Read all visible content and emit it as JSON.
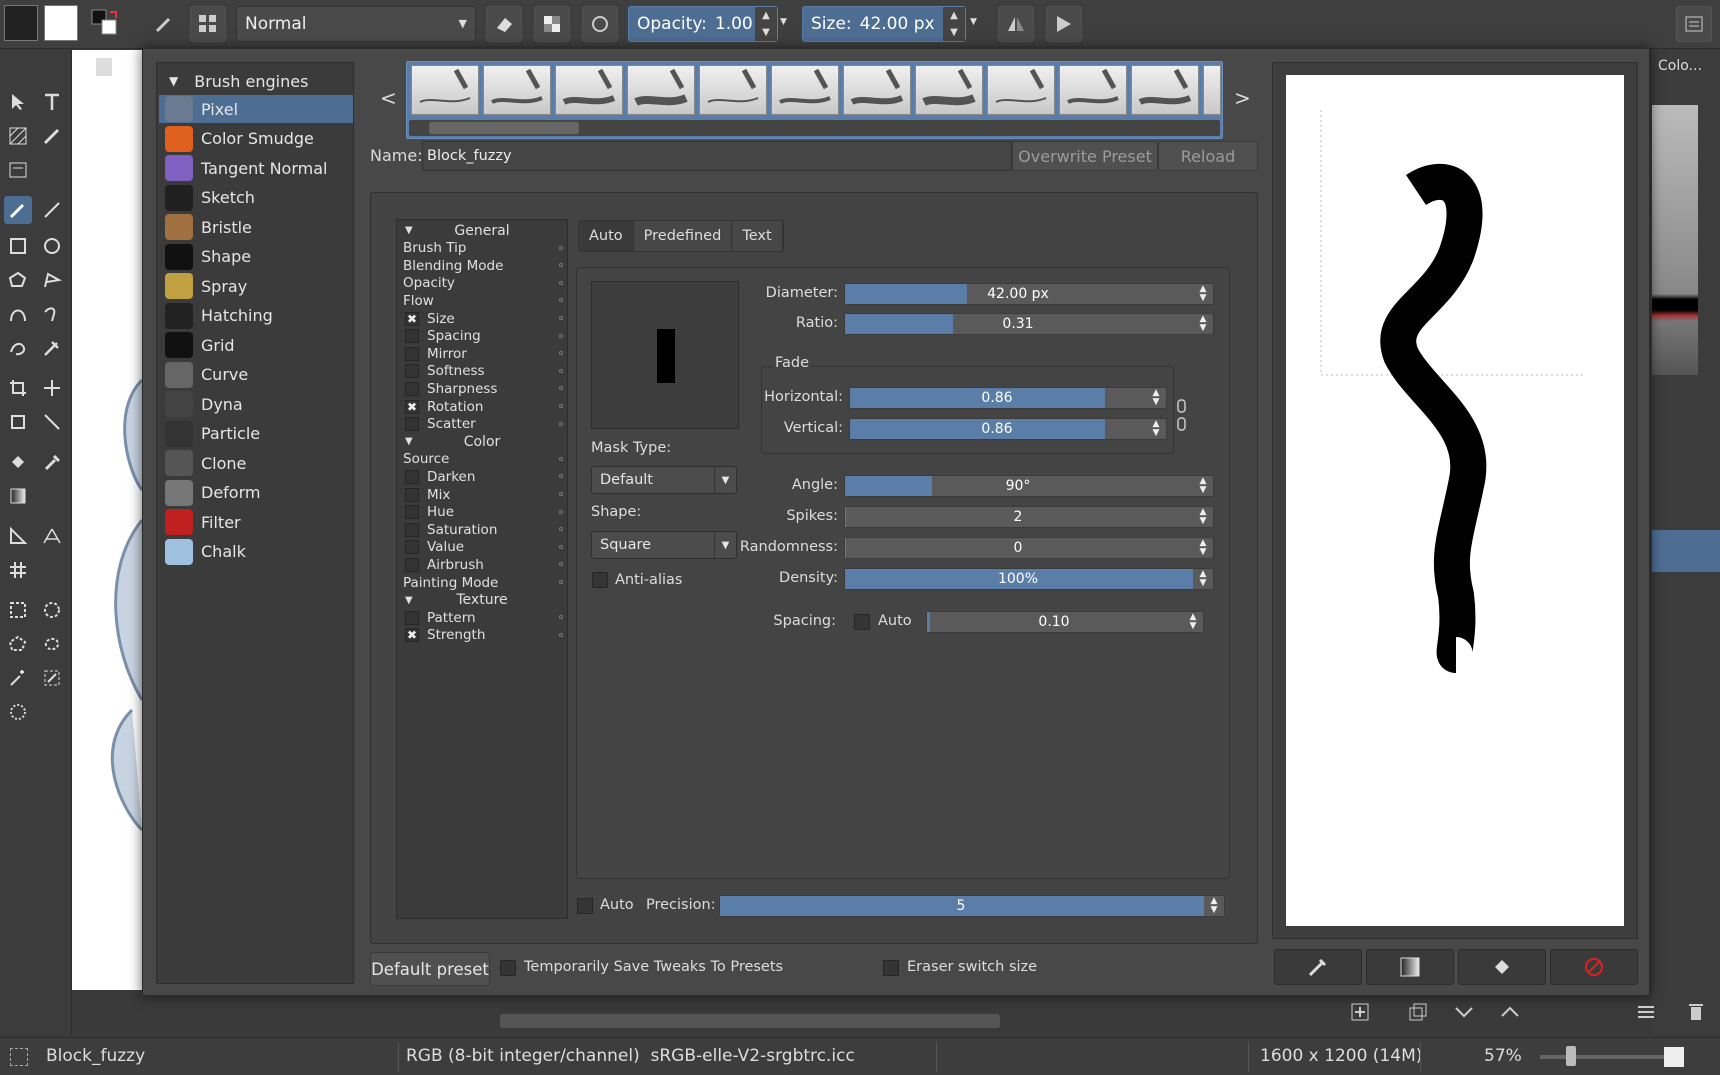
{
  "toolbar": {
    "blend_mode": "Normal",
    "opacity_label": "Opacity:",
    "opacity_value": "1.00",
    "size_label": "Size:",
    "size_value": "42.00 px"
  },
  "engines": {
    "header": "Brush engines",
    "items": [
      {
        "label": "Pixel",
        "color": "#6a7a90"
      },
      {
        "label": "Color Smudge",
        "color": "#e06020"
      },
      {
        "label": "Tangent Normal",
        "color": "#8060c0"
      },
      {
        "label": "Sketch",
        "color": "#202020"
      },
      {
        "label": "Bristle",
        "color": "#a07040"
      },
      {
        "label": "Shape",
        "color": "#111111"
      },
      {
        "label": "Spray",
        "color": "#c0a040"
      },
      {
        "label": "Hatching",
        "color": "#222222"
      },
      {
        "label": "Grid",
        "color": "#111111"
      },
      {
        "label": "Curve",
        "color": "#666666"
      },
      {
        "label": "Dyna",
        "color": "#444444"
      },
      {
        "label": "Particle",
        "color": "#333333"
      },
      {
        "label": "Clone",
        "color": "#555555"
      },
      {
        "label": "Deform",
        "color": "#777777"
      },
      {
        "label": "Filter",
        "color": "#c02020"
      },
      {
        "label": "Chalk",
        "color": "#a0c0e0"
      }
    ],
    "selected": "Pixel"
  },
  "preset": {
    "name_label": "Name:",
    "name_value": "Block_fuzzy",
    "overwrite": "Overwrite Preset",
    "reload": "Reload"
  },
  "options": {
    "general_header": "General",
    "general": [
      {
        "label": "Brush Tip",
        "check": "none"
      },
      {
        "label": "Blending Mode",
        "check": "none"
      },
      {
        "label": "Opacity",
        "check": "none"
      },
      {
        "label": "Flow",
        "check": "none"
      },
      {
        "label": "Size",
        "check": "x"
      },
      {
        "label": "Spacing",
        "check": "box"
      },
      {
        "label": "Mirror",
        "check": "box"
      },
      {
        "label": "Softness",
        "check": "box"
      },
      {
        "label": "Sharpness",
        "check": "box"
      },
      {
        "label": "Rotation",
        "check": "x"
      },
      {
        "label": "Scatter",
        "check": "box"
      }
    ],
    "color_header": "Color",
    "color": [
      {
        "label": "Source",
        "check": "none"
      },
      {
        "label": "Darken",
        "check": "box"
      },
      {
        "label": "Mix",
        "check": "box"
      },
      {
        "label": "Hue",
        "check": "box"
      },
      {
        "label": "Saturation",
        "check": "box"
      },
      {
        "label": "Value",
        "check": "box"
      },
      {
        "label": "Airbrush",
        "check": "box"
      },
      {
        "label": "Painting Mode",
        "check": "none"
      }
    ],
    "texture_header": "Texture",
    "texture": [
      {
        "label": "Pattern",
        "check": "box"
      },
      {
        "label": "Strength",
        "check": "x"
      }
    ]
  },
  "tip_tabs": [
    "Auto",
    "Predefined",
    "Text"
  ],
  "tip": {
    "mask_type_label": "Mask Type:",
    "mask_type": "Default",
    "shape_label": "Shape:",
    "shape": "Square",
    "antialias": "Anti-alias",
    "diameter_label": "Diameter:",
    "diameter": "42.00 px",
    "diameter_fill": 0.35,
    "ratio_label": "Ratio:",
    "ratio": "0.31",
    "ratio_fill": 0.31,
    "fade_label": "Fade",
    "horizontal_label": "Horizontal:",
    "horizontal": "0.86",
    "horizontal_fill": 0.86,
    "vertical_label": "Vertical:",
    "vertical": "0.86",
    "vertical_fill": 0.86,
    "angle_label": "Angle:",
    "angle": "90°",
    "angle_fill": 0.25,
    "spikes_label": "Spikes:",
    "spikes": "2",
    "spikes_fill": 0.0,
    "randomness_label": "Randomness:",
    "randomness": "0",
    "randomness_fill": 0.0,
    "density_label": "Density:",
    "density": "100%",
    "density_fill": 1.0,
    "spacing_label": "Spacing:",
    "spacing_auto": "Auto",
    "spacing": "0.10",
    "spacing_fill": 0.01,
    "precision_auto": "Auto",
    "precision_label": "Precision:",
    "precision": "5",
    "precision_fill": 1.0
  },
  "footer": {
    "default_preset": "Default preset",
    "temp_save": "Temporarily Save Tweaks To Presets",
    "eraser_switch": "Eraser switch size"
  },
  "dock": {
    "colo_tab": "Colo..."
  },
  "status": {
    "preset_name": "Block_fuzzy",
    "color_model": "RGB (8-bit integer/channel)  sRGB-elle-V2-srgbtrc.icc",
    "dimensions": "1600 x 1200 (14M)",
    "zoom": "57%"
  }
}
